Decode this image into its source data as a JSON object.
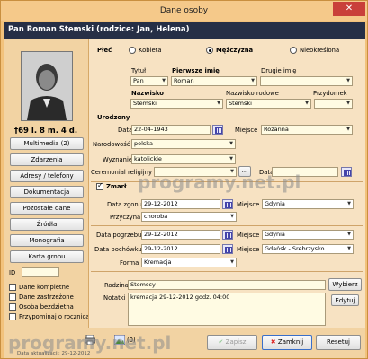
{
  "window": {
    "title": "Dane osoby",
    "close": "✕"
  },
  "header": {
    "text": "Pan Roman Stemski (rodzice: Jan, Helena)"
  },
  "left": {
    "age": "†69 l. 8 m. 4 d.",
    "buttons": [
      "Multimedia (2)",
      "Zdarzenia",
      "Adresy / telefony",
      "Dokumentacja",
      "Pozostałe dane",
      "Źródła",
      "Monografia",
      "Karta grobu"
    ],
    "id_label": "ID",
    "id_value": "",
    "checks": [
      "Dane kompletne",
      "Dane zastrzeżone",
      "Osoba bezdzietna",
      "Przypominaj o rocznicach"
    ]
  },
  "sex": {
    "label": "Płeć",
    "options": [
      "Kobieta",
      "Mężczyzna",
      "Nieokreślona"
    ],
    "selected": "Mężczyzna"
  },
  "name": {
    "tytul_label": "Tytuł",
    "tytul": "Pan",
    "first_label": "Pierwsze imię",
    "first": "Roman",
    "second_label": "Drugie imię",
    "second": "",
    "surname_label": "Nazwisko",
    "surname": "Stemski",
    "family_label": "Nazwisko rodowe",
    "family": "Stemski",
    "nick_label": "Przydomek",
    "nick": ""
  },
  "birth": {
    "section": "Urodzony",
    "date_label": "Data",
    "date": "22-04-1943",
    "place_label": "Miejsce",
    "place": "Różanna",
    "nat_label": "Narodowość",
    "nat": "polska",
    "rel_label": "Wyznanie",
    "rel": "katolickie",
    "cer_label": "Ceremonial religijny",
    "cer": "",
    "cer_date_label": "Data",
    "cer_date": "",
    "dots": "..."
  },
  "death": {
    "section": "Zmarł",
    "date_label": "Data zgonu",
    "date": "29-12-2012",
    "place_label": "Miejsce",
    "place": "Gdynia",
    "cause_label": "Przyczyna",
    "cause": "choroba",
    "burial_label": "Data pogrzebu",
    "burial": "29-12-2012",
    "burial_place_label": "Miejsce",
    "burial_place": "Gdynia",
    "inter_label": "Data pochówku",
    "inter": "29-12-2012",
    "inter_place_label": "Miejsce",
    "inter_place": "Gdańsk - Srebrzysko",
    "form_label": "Forma",
    "form": "Kremacja"
  },
  "family": {
    "label": "Rodzina",
    "value": "Stemscy",
    "select_btn": "Wybierz"
  },
  "notes": {
    "label": "Notatki",
    "value": "kremacja 29-12-2012 godz. 04:00",
    "edit_btn": "Edytuj"
  },
  "bottom": {
    "count_label": "(0)",
    "save": "Zapisz",
    "close": "Zamknij",
    "reset": "Resetuj",
    "updated": "Data aktualizacji: 29-12-2012"
  },
  "watermark": "programy.net.pl"
}
